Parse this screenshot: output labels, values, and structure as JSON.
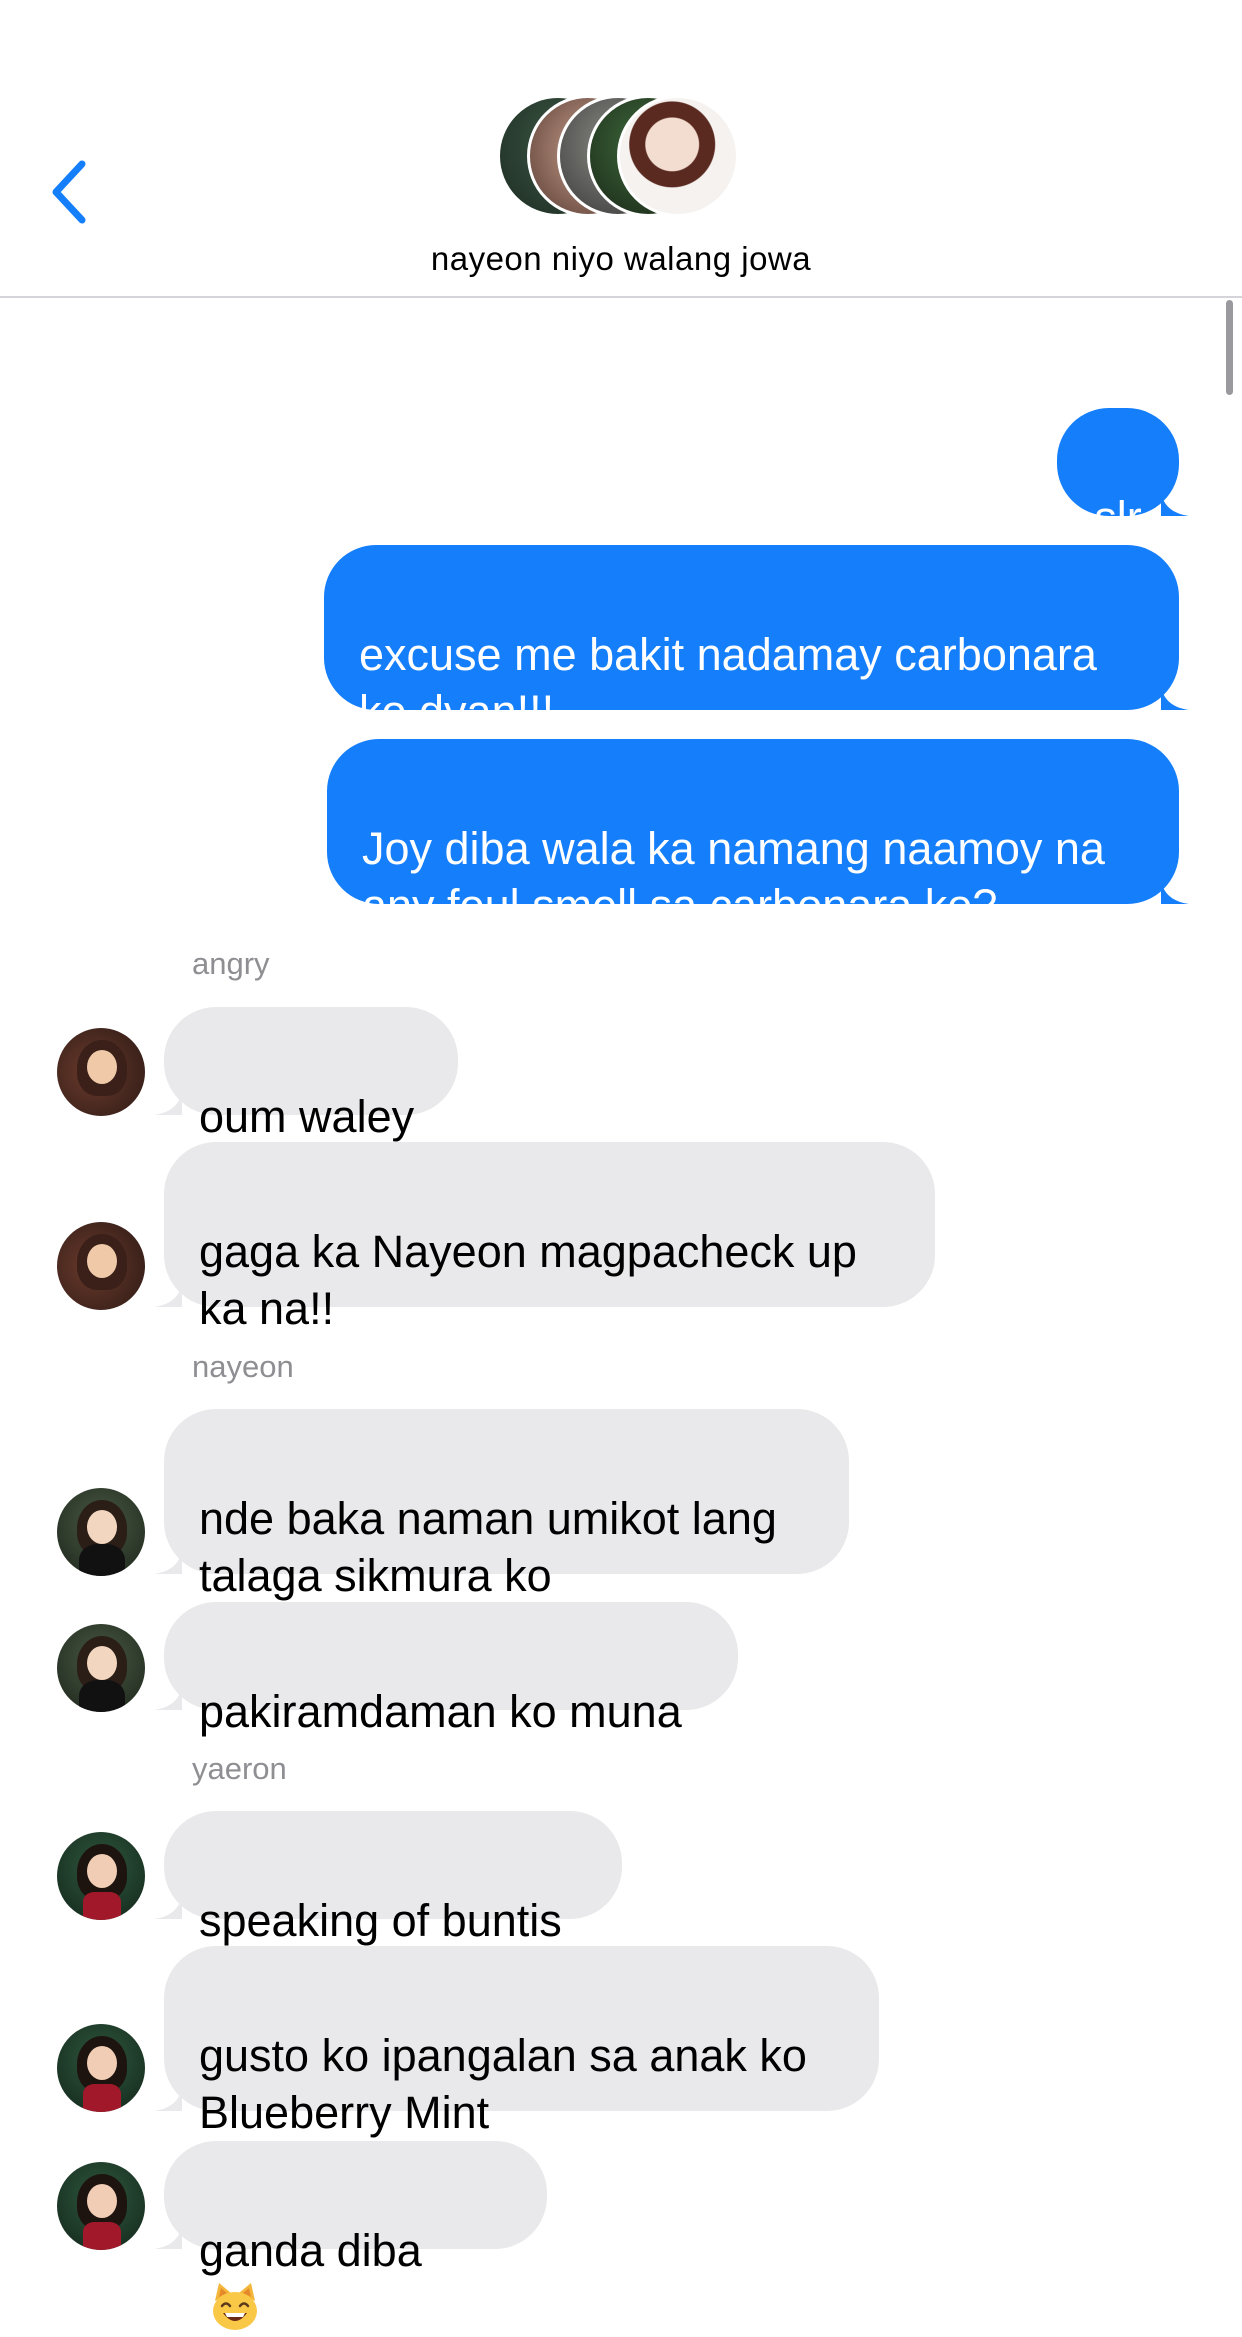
{
  "header": {
    "group_name": "nayeon niyo walang jowa",
    "back_icon": "chevron-left-icon",
    "accent_color": "#147efb"
  },
  "messages_out": [
    {
      "text": "slr"
    },
    {
      "text": "excuse me bakit nadamay carbonara\nko dyan!!!"
    },
    {
      "text": "Joy diba wala ka namang naamoy na\nany foul smell sa carbonara ko?"
    }
  ],
  "groups": [
    {
      "sender": "angry",
      "messages": [
        {
          "text": "oum waley"
        },
        {
          "text": "gaga ka Nayeon magpacheck up\nka na!!"
        }
      ]
    },
    {
      "sender": "nayeon",
      "messages": [
        {
          "text": "nde baka naman umikot lang\ntalaga sikmura ko"
        },
        {
          "text": "pakiramdaman ko muna"
        }
      ]
    },
    {
      "sender": "yaeron",
      "messages": [
        {
          "text": "speaking of buntis"
        },
        {
          "text": "gusto ko ipangalan sa anak ko\nBlueberry Mint"
        },
        {
          "text": "ganda diba",
          "emoji": "smiling-cat-emoji"
        }
      ]
    }
  ],
  "colors": {
    "outgoing_bubble": "#147efb",
    "incoming_bubble": "#e9e9eb",
    "sender_label": "#8e8e93"
  }
}
